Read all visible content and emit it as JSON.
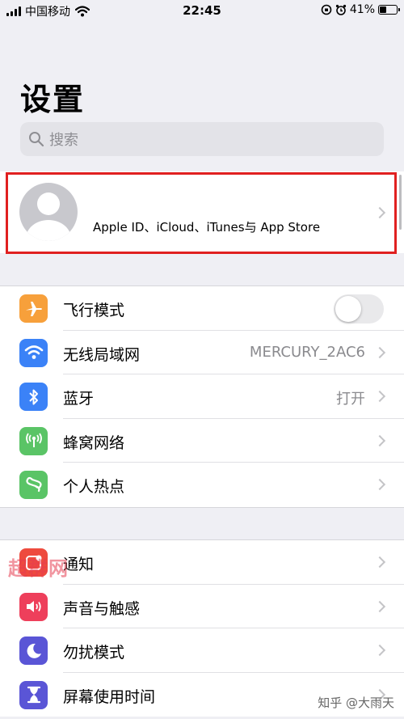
{
  "status_bar": {
    "carrier": "中国移动",
    "time": "22:45",
    "battery": "41%"
  },
  "title": "设置",
  "search": {
    "placeholder": "搜索"
  },
  "apple_id": {
    "label": "Apple ID、iCloud、iTunes与 App Store"
  },
  "group1": [
    {
      "label": "飞行模式",
      "icon": "airplane-icon",
      "color": "#f7a03b",
      "toggle": false
    },
    {
      "label": "无线局域网",
      "icon": "wifi-icon",
      "color": "#3b82f7",
      "value": "MERCURY_2AC6"
    },
    {
      "label": "蓝牙",
      "icon": "bluetooth-icon",
      "color": "#3b82f7",
      "value": "打开"
    },
    {
      "label": "蜂窝网络",
      "icon": "cellular-icon",
      "color": "#5ac466"
    },
    {
      "label": "个人热点",
      "icon": "hotspot-icon",
      "color": "#5ac466"
    }
  ],
  "group2": [
    {
      "label": "通知",
      "icon": "notifications-icon",
      "color": "#ee4b3e"
    },
    {
      "label": "声音与触感",
      "icon": "sound-icon",
      "color": "#ee3f5b"
    },
    {
      "label": "勿扰模式",
      "icon": "moon-icon",
      "color": "#5a55d6"
    },
    {
      "label": "屏幕使用时间",
      "icon": "hourglass-icon",
      "color": "#5a55d6"
    }
  ],
  "watermark": "超群网",
  "attribution": "知乎 @大雨天"
}
